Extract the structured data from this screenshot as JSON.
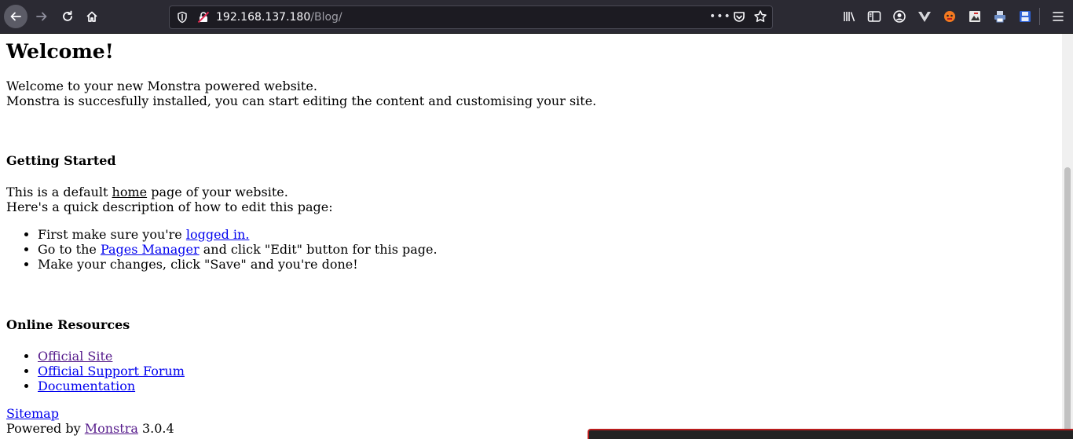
{
  "browser": {
    "url_host": "192.168.137.180",
    "url_path": "/Blog/",
    "url_more": "•••"
  },
  "page": {
    "title": "Welcome!",
    "intro_line1": "Welcome to your new Monstra powered website.",
    "intro_line2": "Monstra is succesfully installed, you can start editing the content and customising your site.",
    "getting_started": {
      "heading": "Getting Started",
      "line1_prefix": "This is a default ",
      "line1_link": "home",
      "line1_suffix": " page of your website.",
      "line2": "Here's a quick description of how to edit this page:",
      "steps": {
        "s1_prefix": "First make sure you're ",
        "s1_link": "logged in.",
        "s2_prefix": "Go to the ",
        "s2_link": "Pages Manager",
        "s2_suffix": " and click \"Edit\" button for this page.",
        "s3": "Make your changes, click \"Save\" and you're done!"
      }
    },
    "online_resources": {
      "heading": "Online Resources",
      "links": [
        "Official Site",
        "Official Support Forum",
        "Documentation"
      ]
    },
    "footer": {
      "sitemap": "Sitemap",
      "powered_prefix": "Powered by ",
      "powered_link": "Monstra",
      "version": " 3.0.4"
    }
  }
}
